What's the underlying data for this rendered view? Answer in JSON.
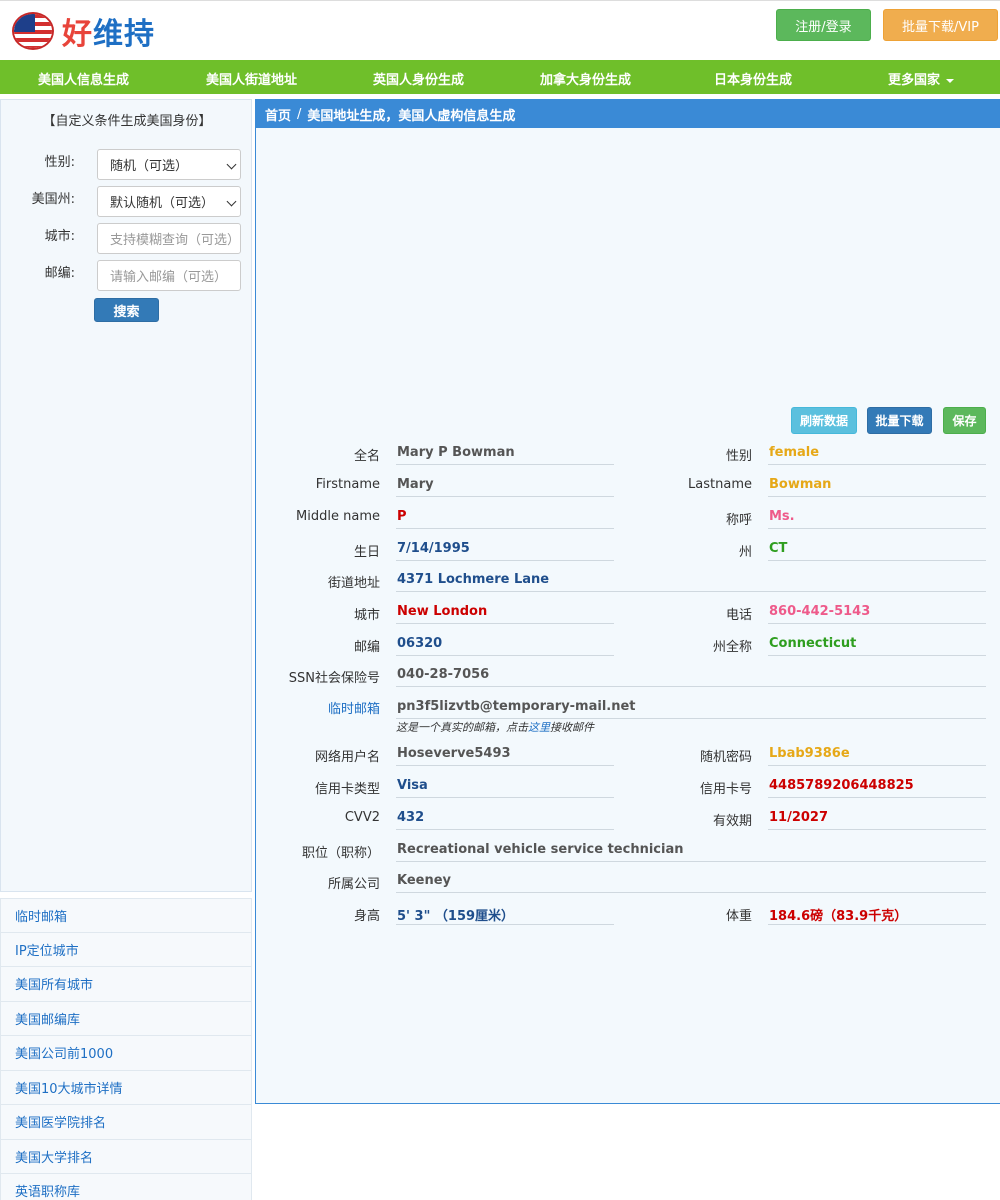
{
  "brand": {
    "name_part1": "好",
    "name_part2": "维持",
    "flag_icon": "us-flag-icon"
  },
  "header": {
    "login_label": "注册/登录",
    "vip_label": "批量下载/VIP"
  },
  "nav": {
    "items": [
      "美国人信息生成",
      "美国人街道地址",
      "英国人身份生成",
      "加拿大身份生成",
      "日本身份生成"
    ],
    "more_label": "更多国家"
  },
  "left_form": {
    "title": "【自定义条件生成美国身份】",
    "gender_label": "性别:",
    "gender_value": "随机（可选）",
    "state_label": "美国州:",
    "state_value": "默认随机（可选）",
    "city_label": "城市:",
    "city_placeholder": "支持模糊查询（可选）",
    "zip_label": "邮编:",
    "zip_placeholder": "请输入邮编（可选）",
    "search_label": "搜索"
  },
  "left_links": [
    "临时邮箱",
    "IP定位城市",
    "美国所有城市",
    "美国邮编库",
    "美国公司前1000",
    "美国10大城市详情",
    "美国医学院排名",
    "美国大学排名",
    "英语职称库"
  ],
  "breadcrumb": {
    "home": "首页",
    "separator": "/",
    "current": "美国地址生成，美国人虚构信息生成"
  },
  "actions": {
    "refresh": "刷新数据",
    "batch": "批量下载",
    "save": "保存"
  },
  "colors": {
    "nav_green": "#6fbf2a",
    "panel_blue": "#3a8ad6",
    "value_blue": "#1f4e8c",
    "value_red": "#cc0000",
    "value_orange": "#e6a817",
    "value_green": "#2e9e1f",
    "value_pink": "#ee5a8a",
    "value_gray": "#555555"
  },
  "fields": {
    "fullname_label": "全名",
    "fullname": "Mary P Bowman",
    "gender_label": "性别",
    "gender": "female",
    "firstname_label": "Firstname",
    "firstname": "Mary",
    "lastname_label": "Lastname",
    "lastname": "Bowman",
    "middlename_label": "Middle name",
    "middlename": "P",
    "title_label": "称呼",
    "title": "Ms.",
    "birthday_label": "生日",
    "birthday": "7/14/1995",
    "state_label": "州",
    "state": "CT",
    "street_label": "街道地址",
    "street": "4371 Lochmere Lane",
    "city_label": "城市",
    "city": "New London",
    "phone_label": "电话",
    "phone": "860-442-5143",
    "zip_label": "邮编",
    "zip": "06320",
    "state_full_label": "州全称",
    "state_full": "Connecticut",
    "ssn_label": "SSN社会保险号",
    "ssn": "040-28-7056",
    "temp_email_label": "临时邮箱",
    "temp_email": "pn3f5lizvtb@temporary-mail.net",
    "email_note_prefix": "这是一个真实的邮箱，点击",
    "email_note_link": "这里",
    "email_note_suffix": "接收邮件",
    "username_label": "网络用户名",
    "username": "Hoseverve5493",
    "password_label": "随机密码",
    "password": "Lbab9386e",
    "card_type_label": "信用卡类型",
    "card_type": "Visa",
    "card_number_label": "信用卡号",
    "card_number": "4485789206448825",
    "cvv_label": "CVV2",
    "cvv": "432",
    "expiry_label": "有效期",
    "expiry": "11/2027",
    "job_label": "职位（职称）",
    "job": "Recreational vehicle service technician",
    "company_label": "所属公司",
    "company": "Keeney",
    "height_label": "身高",
    "height": "5' 3\" （159厘米）",
    "weight_label": "体重",
    "weight": "184.6磅（83.9千克）"
  }
}
